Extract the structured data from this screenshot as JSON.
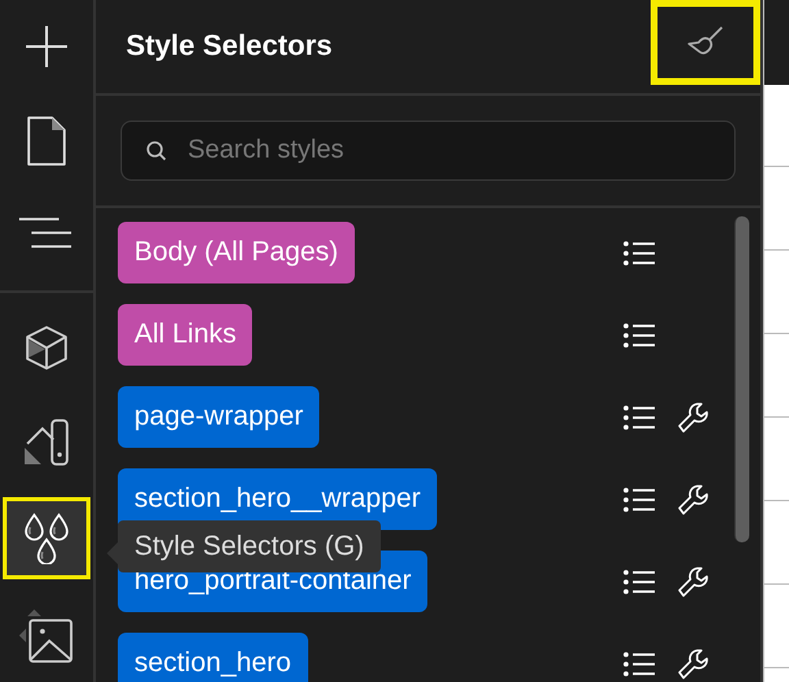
{
  "rail": {
    "items": [
      {
        "kind": "add",
        "selected": false,
        "highlighted": false
      },
      {
        "kind": "pages",
        "selected": false,
        "highlighted": false
      },
      {
        "kind": "navigator",
        "selected": false,
        "highlighted": false
      },
      {
        "kind": "components",
        "selected": false,
        "highlighted": false
      },
      {
        "kind": "swatches",
        "selected": false,
        "highlighted": false
      },
      {
        "kind": "drops",
        "selected": true,
        "highlighted": true
      },
      {
        "kind": "assets",
        "selected": false,
        "highlighted": false
      }
    ]
  },
  "panel": {
    "title": "Style Selectors",
    "clean_button": {
      "highlighted": true
    },
    "search": {
      "placeholder": "Search styles"
    },
    "selectors": [
      {
        "label": "Body (All Pages)",
        "kind": "global"
      },
      {
        "label": "All Links",
        "kind": "global"
      },
      {
        "label": "page-wrapper",
        "kind": "class"
      },
      {
        "label": "section_hero__wrapper",
        "kind": "class"
      },
      {
        "label": "hero_portrait-container",
        "kind": "class"
      },
      {
        "label": "section_hero",
        "kind": "class"
      }
    ]
  },
  "tooltip": {
    "text": "Style Selectors (G)"
  }
}
